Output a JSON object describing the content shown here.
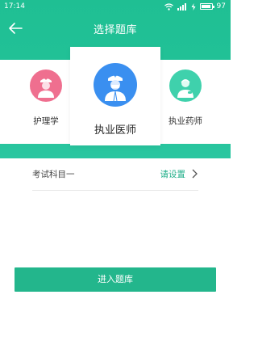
{
  "status_bar": {
    "time": "17:14",
    "battery_level": "97",
    "icons": [
      "wifi-icon",
      "signal-icon",
      "charging-icon",
      "battery-icon"
    ]
  },
  "nav": {
    "title": "选择题库",
    "back_icon": "arrow-left-icon"
  },
  "categories": [
    {
      "label": "护理学",
      "icon": "nurse-avatar-icon",
      "color": "#ef6f8f",
      "selected": false
    },
    {
      "label": "执业医师",
      "icon": "doctor-avatar-icon",
      "color": "#3a8ff0",
      "selected": true
    },
    {
      "label": "执业药师",
      "icon": "pharmacist-avatar-icon",
      "color": "#3fd1ac",
      "selected": false
    }
  ],
  "subject": {
    "label": "考试科目一",
    "value": "请设置",
    "icon": "chevron-right-icon"
  },
  "enter_button": {
    "label": "进入题库"
  },
  "colors": {
    "header_green": "#1fbf93",
    "accent_green": "#23b68c",
    "link_green": "#1fae88"
  }
}
